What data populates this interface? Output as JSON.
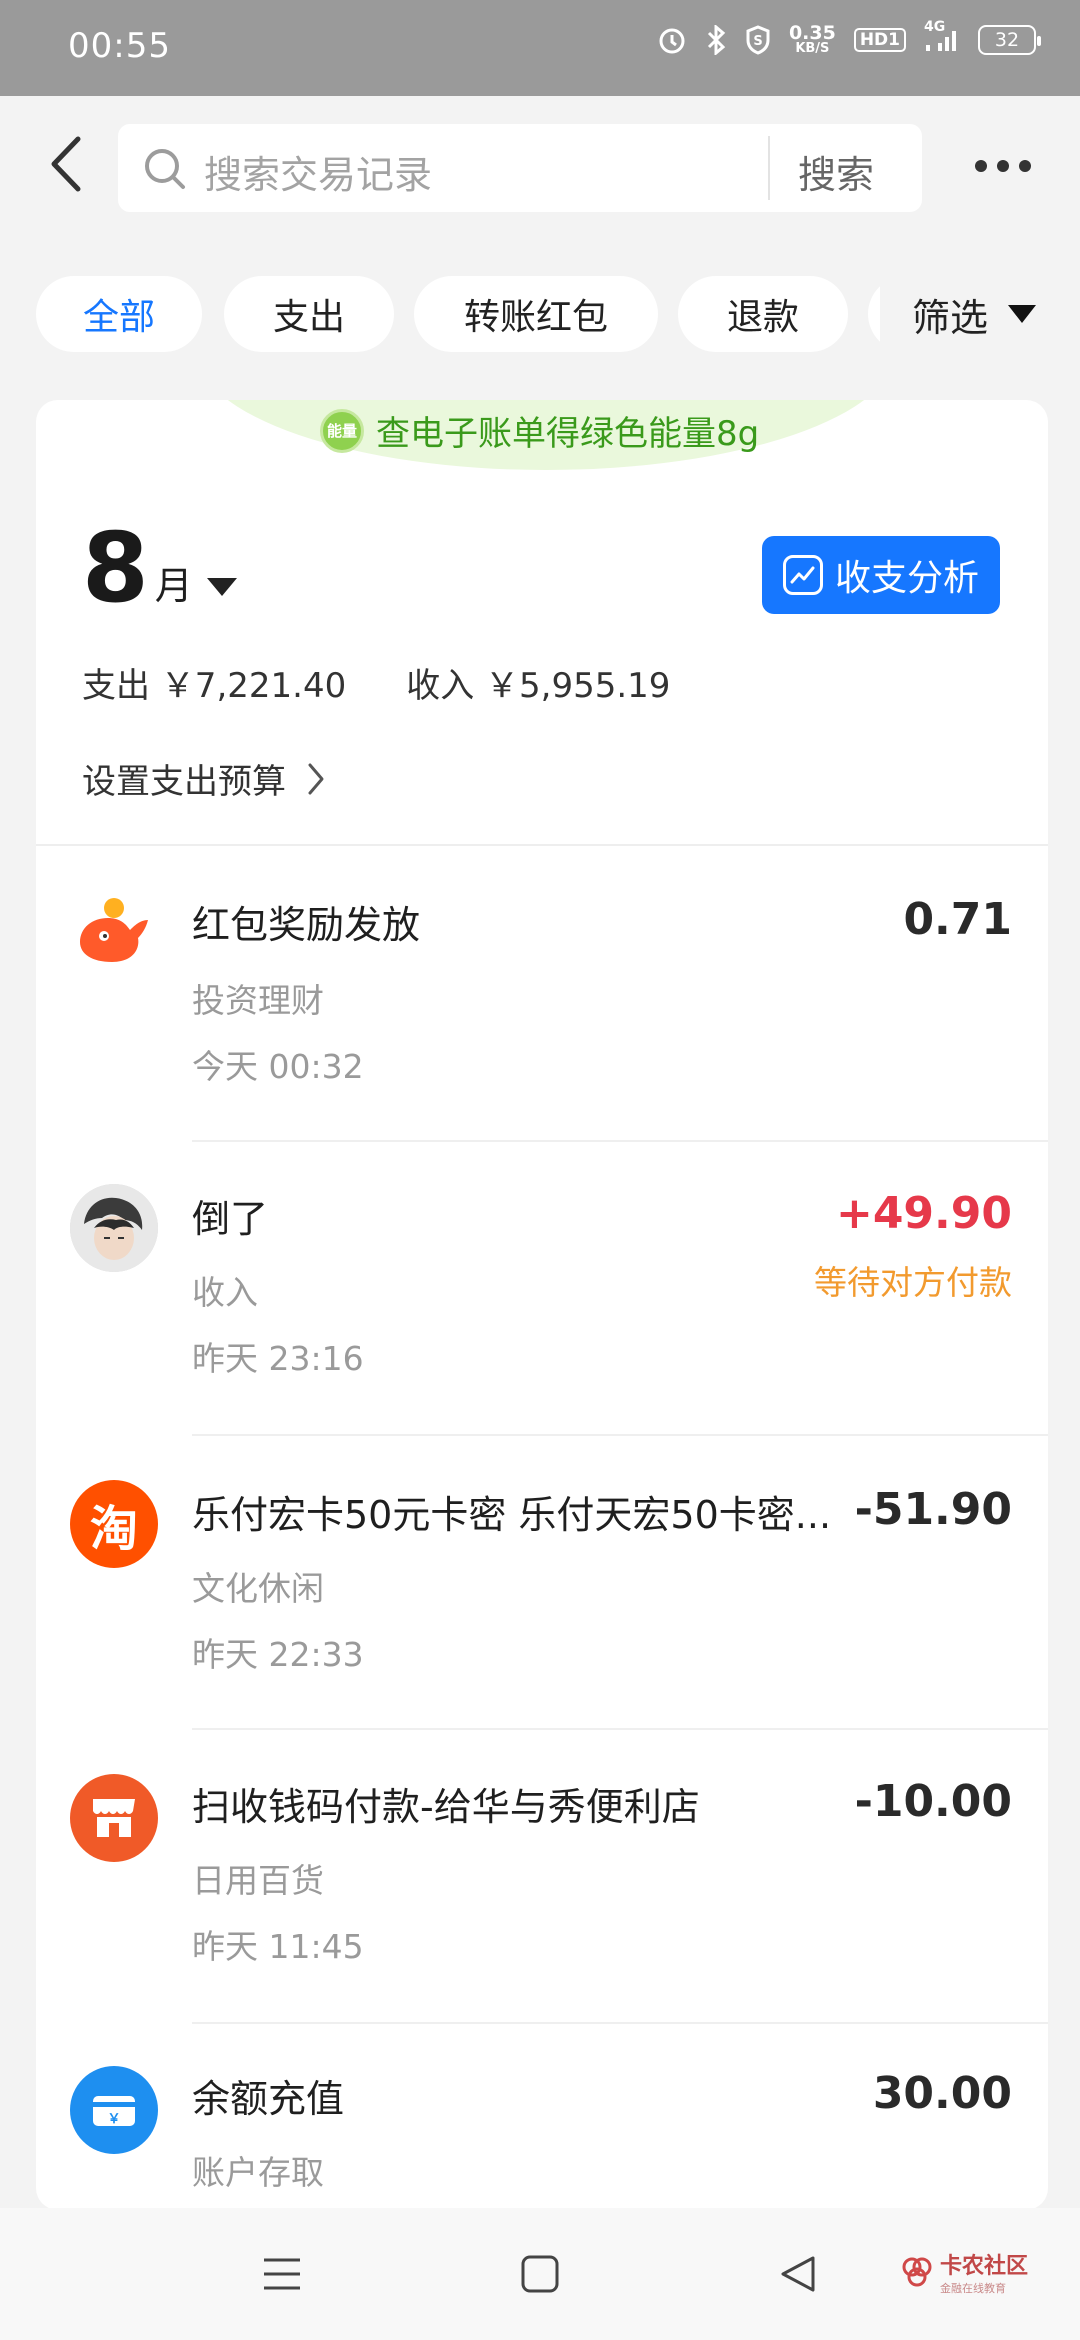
{
  "status_bar": {
    "time": "00:55",
    "net_speed_value": "0.35",
    "net_speed_unit": "KB/S",
    "hd_label": "HD1",
    "signal_label": "4G",
    "battery": "32"
  },
  "header": {
    "search_placeholder": "搜索交易记录",
    "search_button": "搜索"
  },
  "chips": {
    "all": "全部",
    "expense": "支出",
    "transfer": "转账红包",
    "refund": "退款",
    "filter": "筛选"
  },
  "energy": {
    "badge": "能量",
    "text": "查电子账单得绿色能量8g"
  },
  "month": {
    "number": "8",
    "unit": "月",
    "analysis_button": "收支分析"
  },
  "summary": {
    "expense": "支出 ￥7,221.40",
    "income": "收入 ￥5,955.19"
  },
  "budget": {
    "label": "设置支出预算"
  },
  "transactions": [
    {
      "title": "红包奖励发放",
      "category": "投资理财",
      "time": "今天 00:32",
      "amount": "0.71",
      "status": "",
      "icon": "whale-icon"
    },
    {
      "title": "倒了",
      "category": "收入",
      "time": "昨天 23:16",
      "amount": "+49.90",
      "status": "等待对方付款",
      "icon": "user-avatar"
    },
    {
      "title": "乐付宏卡50元卡密 乐付天宏50卡密...",
      "category": "文化休闲",
      "time": "昨天 22:33",
      "amount": "-51.90",
      "status": "",
      "icon": "taobao-icon",
      "icon_char": "淘"
    },
    {
      "title": "扫收钱码付款-给华与秀便利店",
      "category": "日用百货",
      "time": "昨天 11:45",
      "amount": "-10.00",
      "status": "",
      "icon": "store-icon"
    },
    {
      "title": "余额充值",
      "category": "账户存取",
      "time": "",
      "amount": "30.00",
      "status": "",
      "icon": "wallet-icon",
      "icon_char": "￥"
    }
  ],
  "watermark": {
    "title": "卡农社区",
    "subtitle": "金融在线教育"
  },
  "colors": {
    "accent": "#1677ff",
    "income": "#e6394a",
    "pending": "#f29a2e",
    "energy": "#3a9a1b"
  }
}
